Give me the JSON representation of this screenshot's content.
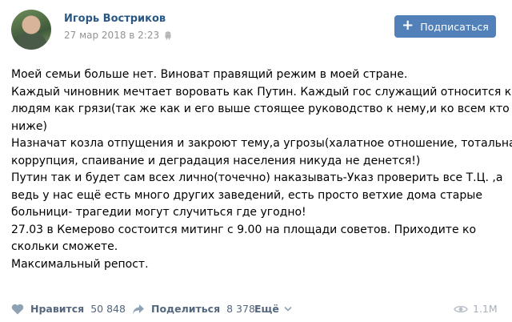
{
  "author": {
    "name": "Игорь Востриков",
    "date": "27 мар 2018 в 2:23"
  },
  "subscribe_label": "Подписаться",
  "post_lines": [
    "Моей семьи больше нет. Виноват правящий режим в моей стране.",
    "Каждый чиновник мечтает воровать как Путин. Каждый гос служащий относится к",
    "людям как грязи(так же как и его выше стоящее руководство к нему,и ко всем кто",
    "ниже)",
    "Назначат козла отпущения и закроют тему,а угрозы(халатное отношение, тотальная",
    "коррупция, спаивание и деградация населения никуда не денется!)",
    "Путин так и будет сам всех лично(точечно) наказывать-Указ проверить все Т.Ц. ,а",
    "ведь у нас ещё есть много других заведений, есть просто ветхие дома старые",
    "больници- трагедии могут случиться где угодно!",
    "27.03 в Кемерово состоится митинг с 9.00 на площади советов. Приходите ко",
    "скольки сможете.",
    "Максимальный репост."
  ],
  "actions": {
    "like_label": "Нравится",
    "like_count": "50 848",
    "share_label": "Поделиться",
    "share_count": "8 378",
    "more_label": "Ещё"
  },
  "views": "1.1M",
  "colors": {
    "accent": "#5181b8",
    "link": "#2a5885",
    "muted": "#939393"
  }
}
